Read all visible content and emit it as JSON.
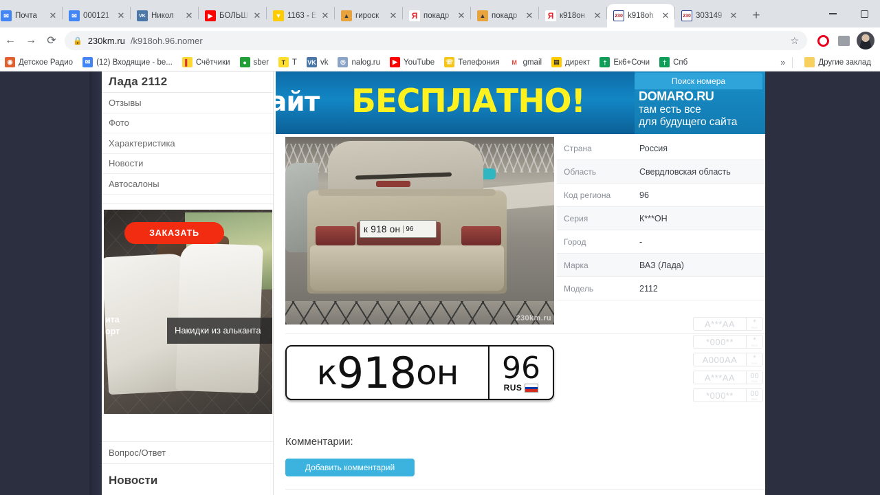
{
  "browser": {
    "tabs": [
      {
        "title": "Почта",
        "favicon": "mail-icon",
        "color": "#4285f4",
        "glyph": "✉",
        "active": false
      },
      {
        "title": "000121",
        "favicon": "mail-icon",
        "color": "#4285f4",
        "glyph": "✉",
        "active": false
      },
      {
        "title": "Никол",
        "favicon": "vk-icon",
        "color": "#4a76a8",
        "glyph": "VK",
        "active": false
      },
      {
        "title": "БОЛЬШ",
        "favicon": "youtube-icon",
        "color": "#ff0000",
        "glyph": "▶",
        "active": false
      },
      {
        "title": "1163 - Е",
        "favicon": "yandex-disk-icon",
        "color": "#ffcc00",
        "glyph": "▼",
        "active": false
      },
      {
        "title": "гироск",
        "favicon": "image-icon",
        "color": "#e8a33d",
        "glyph": "▲",
        "active": false
      },
      {
        "title": "покадр",
        "favicon": "yandex-icon",
        "color": "#ffffff",
        "glyph": "Я",
        "active": false
      },
      {
        "title": "покадр",
        "favicon": "image-icon",
        "color": "#e8a33d",
        "glyph": "▲",
        "active": false
      },
      {
        "title": "к918он",
        "favicon": "yandex-icon",
        "color": "#ffffff",
        "glyph": "Я",
        "active": false
      },
      {
        "title": "k918oh",
        "favicon": "plate-230-icon",
        "color": "#ffffff",
        "glyph": "230",
        "active": true
      },
      {
        "title": "303149",
        "favicon": "plate-230-icon",
        "color": "#ffffff",
        "glyph": "230",
        "active": false
      }
    ],
    "new_tab_label": "+",
    "close_label": "✕",
    "window_controls": {
      "minimize": "minimize-icon",
      "maximize": "maximize-icon"
    },
    "nav": {
      "back": "←",
      "forward": "→",
      "reload": "⟳"
    },
    "address": {
      "lock_icon": "lock-icon",
      "host": "230km.ru",
      "path": "/k918oh.96.nomer",
      "full": "230km.ru/k918oh.96.nomer",
      "star_icon": "☆"
    },
    "toolbar_icons": [
      {
        "name": "opera-extension-icon",
        "glyph": "◎",
        "color": "#e8001e"
      },
      {
        "name": "screenshot-extension-icon",
        "glyph": "▣",
        "color": "#7a7a7a"
      }
    ],
    "bookmarks": [
      {
        "label": "Детское Радио",
        "icon": "radio-icon",
        "color": "#e06030",
        "glyph": "◉"
      },
      {
        "label": "(12) Входящие - be...",
        "icon": "mail-icon",
        "color": "#4285f4",
        "glyph": "✉"
      },
      {
        "label": "Счётчики",
        "icon": "metrika-icon",
        "color": "#fdd835",
        "glyph": "▌"
      },
      {
        "label": "sber",
        "icon": "sber-icon",
        "color": "#21a038",
        "glyph": "●"
      },
      {
        "label": "T",
        "icon": "tinkoff-icon",
        "color": "#ffdd2d",
        "glyph": "T"
      },
      {
        "label": "vk",
        "icon": "vk-icon",
        "color": "#4a76a8",
        "glyph": "VK"
      },
      {
        "label": "nalog.ru",
        "icon": "nalog-icon",
        "color": "#8aa4c8",
        "glyph": "◎"
      },
      {
        "label": "YouTube",
        "icon": "youtube-icon",
        "color": "#ff0000",
        "glyph": "▶"
      },
      {
        "label": "Телефония",
        "icon": "phone-icon",
        "color": "#f5c518",
        "glyph": "☏"
      },
      {
        "label": "gmail",
        "icon": "gmail-icon",
        "color": "#ea4335",
        "glyph": "M"
      },
      {
        "label": "директ",
        "icon": "direct-icon",
        "color": "#ffcc00",
        "glyph": "▤"
      },
      {
        "label": "Ек6+Сочи",
        "icon": "calendar-icon",
        "color": "#0f9d58",
        "glyph": "†"
      },
      {
        "label": "Спб",
        "icon": "calendar-icon",
        "color": "#0f9d58",
        "glyph": "†"
      }
    ],
    "bookmarks_overflow": "»",
    "other_bookmarks": {
      "label": "Другие заклад",
      "icon": "folder-icon",
      "color": "#f7d060",
      "glyph": "▮"
    }
  },
  "sidebar": {
    "title": "Лада 2112",
    "items": [
      {
        "label": "Отзывы"
      },
      {
        "label": "Фото"
      },
      {
        "label": "Характеристика"
      },
      {
        "label": "Новости"
      },
      {
        "label": "Автосалоны"
      }
    ],
    "ad": {
      "order_button": "ЗАКАЗАТЬ",
      "caption": "Накидки из альканта",
      "side_text_1": "ита",
      "side_text_2": "орт"
    },
    "qa_label": "Вопрос/Ответ",
    "news_label": "Новости"
  },
  "banner": {
    "text_white": "сайт",
    "text_yellow": "БЕСПЛАТНО!",
    "search_button": "Поиск номера",
    "brand": "DOMARO.RU",
    "line2": "там есть все",
    "line3": "для будущего сайта"
  },
  "photo": {
    "plate_number": "к 918 он",
    "plate_region": "96",
    "watermark": "230km.ru"
  },
  "info_table": {
    "rows": [
      {
        "key": "Страна",
        "value": "Россия"
      },
      {
        "key": "Область",
        "value": "Свердловская область"
      },
      {
        "key": "Код региона",
        "value": "96"
      },
      {
        "key": "Серия",
        "value": "К***ОН"
      },
      {
        "key": "Город",
        "value": "-"
      },
      {
        "key": "Марка",
        "value": "ВАЗ (Лада)"
      },
      {
        "key": "Модель",
        "value": "2112"
      }
    ]
  },
  "patterns": [
    {
      "main": "A***AA",
      "region": "*",
      "rus": "RUS"
    },
    {
      "main": "*000**",
      "region": "*",
      "rus": "RUS"
    },
    {
      "main": "A000AA",
      "region": "*",
      "rus": "RUS"
    },
    {
      "main": "A***AA",
      "region": "00",
      "rus": "RUS"
    },
    {
      "main": "*000**",
      "region": "00",
      "rus": "RUS"
    }
  ],
  "big_plate": {
    "part1": "к",
    "part2": "918",
    "part3": "он",
    "region": "96",
    "rus": "RUS"
  },
  "comments": {
    "title": "Комментарии:",
    "add_button": "Добавить комментарий"
  },
  "colors": {
    "accent_blue": "#3bb3de",
    "banner_yellow": "#fdf21f",
    "ad_red": "#f22c10"
  }
}
